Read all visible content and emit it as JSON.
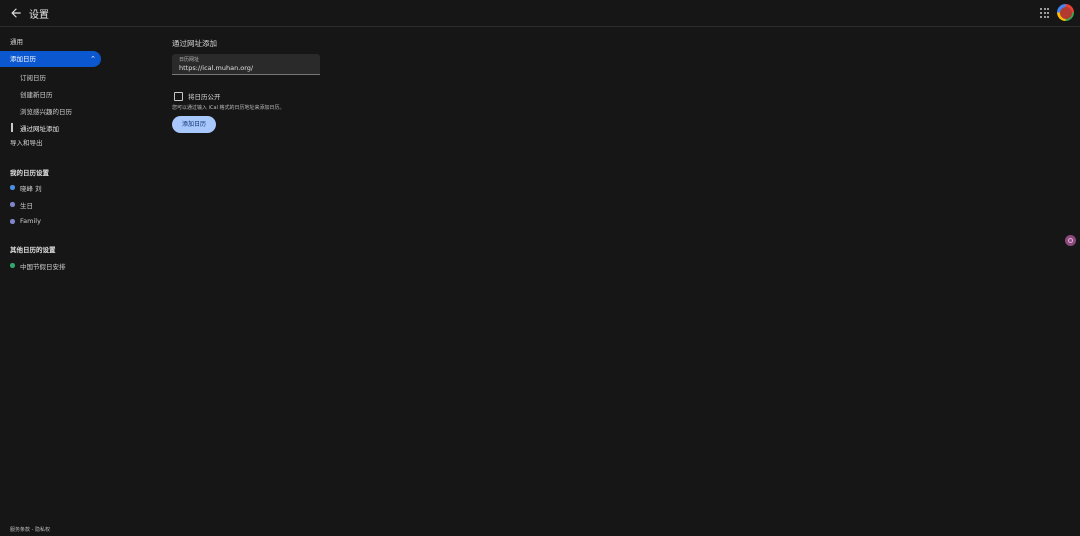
{
  "header": {
    "title": "设置"
  },
  "sidebar": {
    "general": "通用",
    "add_calendar": "添加日历",
    "sub_items": [
      "订阅日历",
      "创建新日历",
      "浏览感兴趣的日历",
      "通过网址添加"
    ],
    "import_export": "导入和导出",
    "my_calendars_header": "我的日历设置",
    "my_calendars": [
      {
        "label": "晓峰 刘",
        "color": "#4a90e2"
      },
      {
        "label": "生日",
        "color": "#7e86c9"
      },
      {
        "label": "Family",
        "color": "#7e86c9"
      }
    ],
    "other_calendars_header": "其他日历的设置",
    "other_calendars": [
      {
        "label": "中国节假日安排",
        "color": "#2ea86a"
      }
    ]
  },
  "main": {
    "heading": "通过网址添加",
    "url_field": {
      "label": "日历网址",
      "value": "https://ical.muhan.org/"
    },
    "checkbox_label": "将日历公开",
    "hint": "您可以通过输入 iCal 格式的日历地址来添加日历。",
    "add_button": "添加日历"
  },
  "footer": {
    "text": "服务条款 - 隐私权"
  },
  "icons": {
    "back": "back-arrow-icon",
    "apps": "apps-grid-icon",
    "chevron": "chevron-up-icon"
  }
}
